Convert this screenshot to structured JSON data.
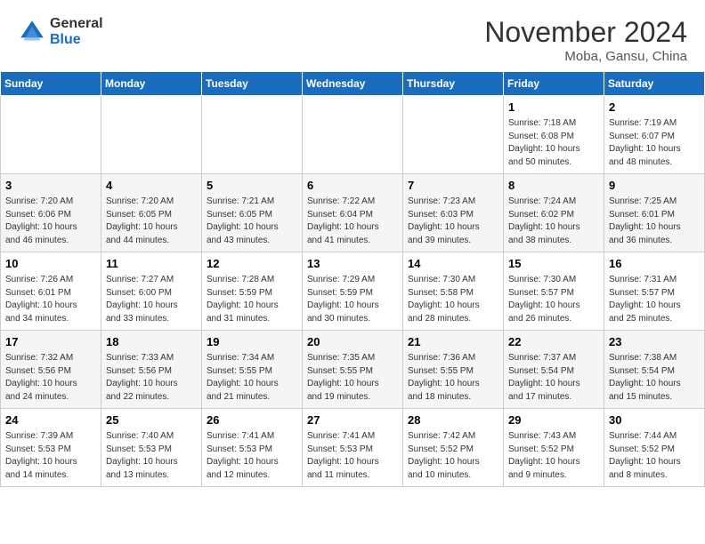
{
  "header": {
    "logo_general": "General",
    "logo_blue": "Blue",
    "title": "November 2024",
    "location": "Moba, Gansu, China"
  },
  "weekdays": [
    "Sunday",
    "Monday",
    "Tuesday",
    "Wednesday",
    "Thursday",
    "Friday",
    "Saturday"
  ],
  "weeks": [
    [
      {
        "day": "",
        "info": ""
      },
      {
        "day": "",
        "info": ""
      },
      {
        "day": "",
        "info": ""
      },
      {
        "day": "",
        "info": ""
      },
      {
        "day": "",
        "info": ""
      },
      {
        "day": "1",
        "info": "Sunrise: 7:18 AM\nSunset: 6:08 PM\nDaylight: 10 hours\nand 50 minutes."
      },
      {
        "day": "2",
        "info": "Sunrise: 7:19 AM\nSunset: 6:07 PM\nDaylight: 10 hours\nand 48 minutes."
      }
    ],
    [
      {
        "day": "3",
        "info": "Sunrise: 7:20 AM\nSunset: 6:06 PM\nDaylight: 10 hours\nand 46 minutes."
      },
      {
        "day": "4",
        "info": "Sunrise: 7:20 AM\nSunset: 6:05 PM\nDaylight: 10 hours\nand 44 minutes."
      },
      {
        "day": "5",
        "info": "Sunrise: 7:21 AM\nSunset: 6:05 PM\nDaylight: 10 hours\nand 43 minutes."
      },
      {
        "day": "6",
        "info": "Sunrise: 7:22 AM\nSunset: 6:04 PM\nDaylight: 10 hours\nand 41 minutes."
      },
      {
        "day": "7",
        "info": "Sunrise: 7:23 AM\nSunset: 6:03 PM\nDaylight: 10 hours\nand 39 minutes."
      },
      {
        "day": "8",
        "info": "Sunrise: 7:24 AM\nSunset: 6:02 PM\nDaylight: 10 hours\nand 38 minutes."
      },
      {
        "day": "9",
        "info": "Sunrise: 7:25 AM\nSunset: 6:01 PM\nDaylight: 10 hours\nand 36 minutes."
      }
    ],
    [
      {
        "day": "10",
        "info": "Sunrise: 7:26 AM\nSunset: 6:01 PM\nDaylight: 10 hours\nand 34 minutes."
      },
      {
        "day": "11",
        "info": "Sunrise: 7:27 AM\nSunset: 6:00 PM\nDaylight: 10 hours\nand 33 minutes."
      },
      {
        "day": "12",
        "info": "Sunrise: 7:28 AM\nSunset: 5:59 PM\nDaylight: 10 hours\nand 31 minutes."
      },
      {
        "day": "13",
        "info": "Sunrise: 7:29 AM\nSunset: 5:59 PM\nDaylight: 10 hours\nand 30 minutes."
      },
      {
        "day": "14",
        "info": "Sunrise: 7:30 AM\nSunset: 5:58 PM\nDaylight: 10 hours\nand 28 minutes."
      },
      {
        "day": "15",
        "info": "Sunrise: 7:30 AM\nSunset: 5:57 PM\nDaylight: 10 hours\nand 26 minutes."
      },
      {
        "day": "16",
        "info": "Sunrise: 7:31 AM\nSunset: 5:57 PM\nDaylight: 10 hours\nand 25 minutes."
      }
    ],
    [
      {
        "day": "17",
        "info": "Sunrise: 7:32 AM\nSunset: 5:56 PM\nDaylight: 10 hours\nand 24 minutes."
      },
      {
        "day": "18",
        "info": "Sunrise: 7:33 AM\nSunset: 5:56 PM\nDaylight: 10 hours\nand 22 minutes."
      },
      {
        "day": "19",
        "info": "Sunrise: 7:34 AM\nSunset: 5:55 PM\nDaylight: 10 hours\nand 21 minutes."
      },
      {
        "day": "20",
        "info": "Sunrise: 7:35 AM\nSunset: 5:55 PM\nDaylight: 10 hours\nand 19 minutes."
      },
      {
        "day": "21",
        "info": "Sunrise: 7:36 AM\nSunset: 5:55 PM\nDaylight: 10 hours\nand 18 minutes."
      },
      {
        "day": "22",
        "info": "Sunrise: 7:37 AM\nSunset: 5:54 PM\nDaylight: 10 hours\nand 17 minutes."
      },
      {
        "day": "23",
        "info": "Sunrise: 7:38 AM\nSunset: 5:54 PM\nDaylight: 10 hours\nand 15 minutes."
      }
    ],
    [
      {
        "day": "24",
        "info": "Sunrise: 7:39 AM\nSunset: 5:53 PM\nDaylight: 10 hours\nand 14 minutes."
      },
      {
        "day": "25",
        "info": "Sunrise: 7:40 AM\nSunset: 5:53 PM\nDaylight: 10 hours\nand 13 minutes."
      },
      {
        "day": "26",
        "info": "Sunrise: 7:41 AM\nSunset: 5:53 PM\nDaylight: 10 hours\nand 12 minutes."
      },
      {
        "day": "27",
        "info": "Sunrise: 7:41 AM\nSunset: 5:53 PM\nDaylight: 10 hours\nand 11 minutes."
      },
      {
        "day": "28",
        "info": "Sunrise: 7:42 AM\nSunset: 5:52 PM\nDaylight: 10 hours\nand 10 minutes."
      },
      {
        "day": "29",
        "info": "Sunrise: 7:43 AM\nSunset: 5:52 PM\nDaylight: 10 hours\nand 9 minutes."
      },
      {
        "day": "30",
        "info": "Sunrise: 7:44 AM\nSunset: 5:52 PM\nDaylight: 10 hours\nand 8 minutes."
      }
    ]
  ]
}
